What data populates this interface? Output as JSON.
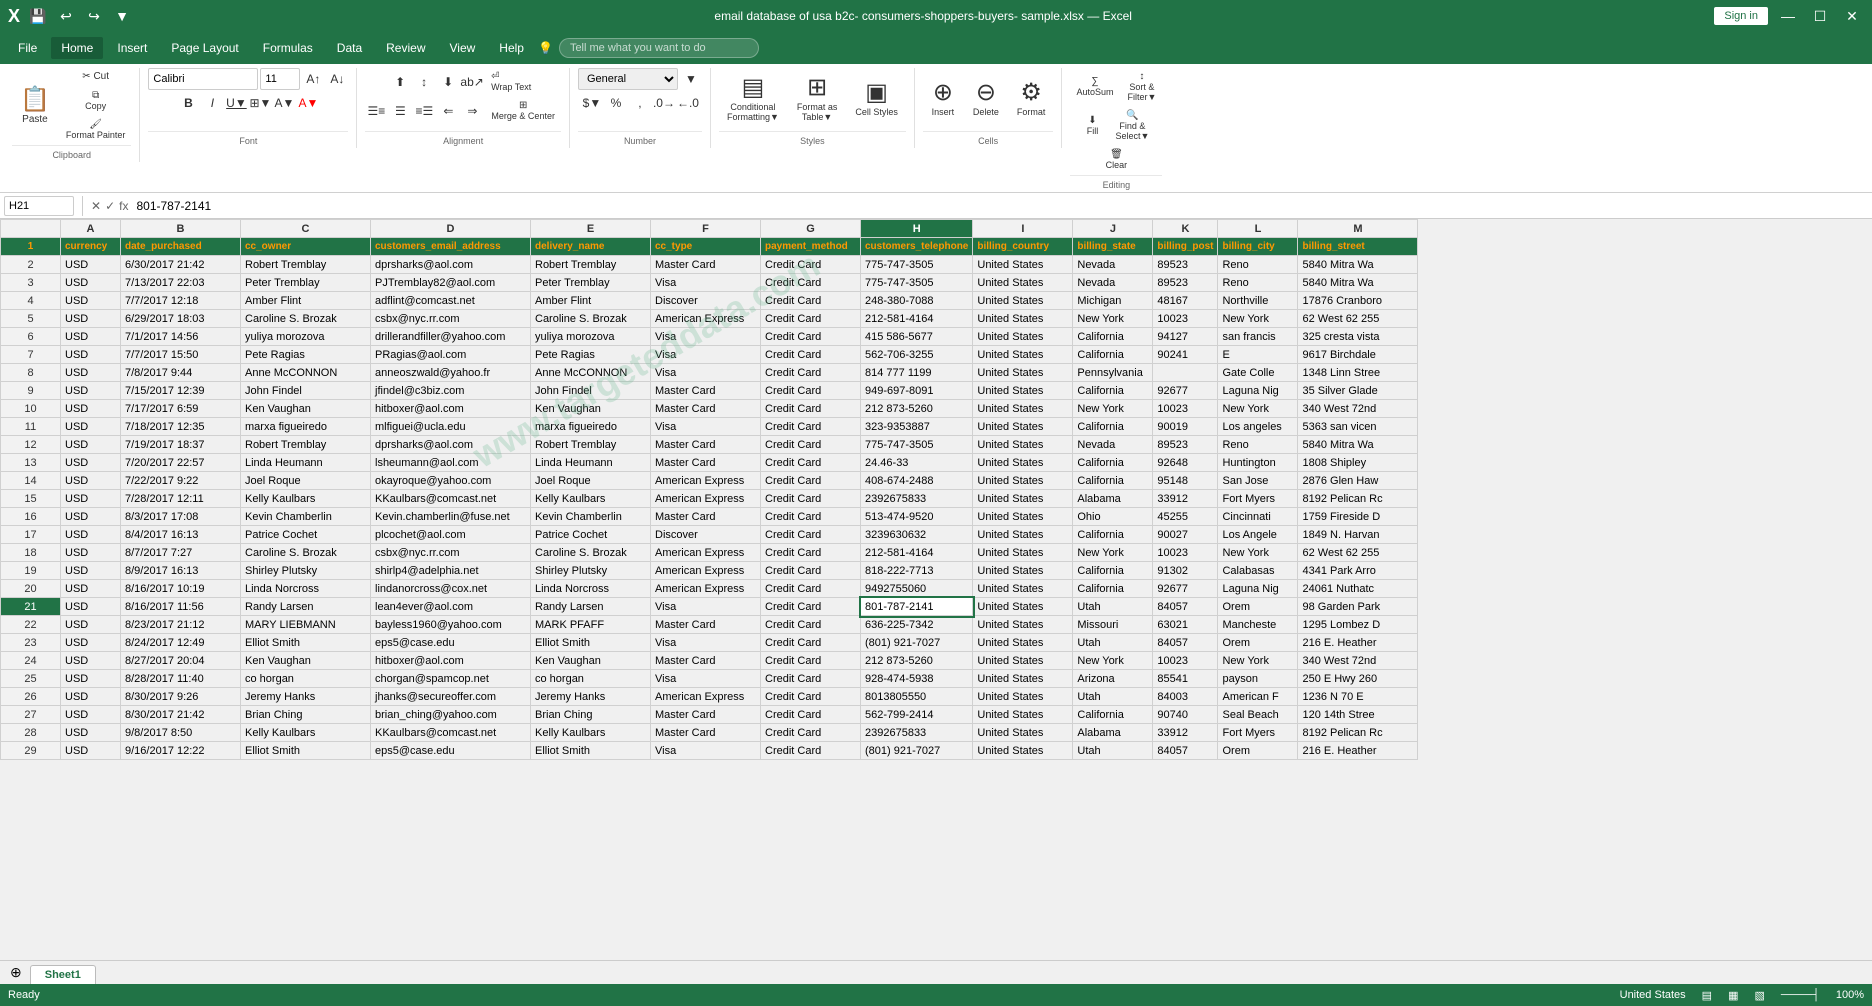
{
  "titleBar": {
    "filename": "email database of usa b2c- consumers-shoppers-buyers- sample.xlsx — Excel",
    "signIn": "Sign in"
  },
  "quickAccess": [
    "💾",
    "↩",
    "↪",
    "▼"
  ],
  "menuItems": [
    "File",
    "Home",
    "Insert",
    "Page Layout",
    "Formulas",
    "Data",
    "Review",
    "View",
    "Help"
  ],
  "activeMenu": "Home",
  "tellMe": {
    "placeholder": "Tell me what you want to do"
  },
  "ribbon": {
    "clipboard": {
      "label": "Clipboard",
      "paste": "Paste",
      "cut": "Cut",
      "copy": "Copy",
      "formatPainter": "Format Painter"
    },
    "font": {
      "label": "Font",
      "fontName": "Calibri",
      "fontSize": "11",
      "bold": "B",
      "italic": "I",
      "underline": "U"
    },
    "alignment": {
      "label": "Alignment",
      "wrapText": "Wrap Text",
      "mergeCenter": "Merge & Center"
    },
    "number": {
      "label": "Number",
      "format": "General"
    },
    "styles": {
      "label": "Styles",
      "conditional": "Conditional Formatting",
      "formatAsTable": "Format as Table",
      "cellStyles": "Cell Styles"
    },
    "cells": {
      "label": "Cells",
      "insert": "Insert",
      "delete": "Delete",
      "format": "Format"
    },
    "editing": {
      "label": "Editing",
      "autoSum": "AutoSum",
      "fill": "Fill",
      "clear": "Clear",
      "sortFilter": "Sort & Filter",
      "findSelect": "Find & Select"
    }
  },
  "formulaBar": {
    "nameBox": "H21",
    "formula": "801-787-2141"
  },
  "headers": [
    "currency",
    "date_purchased",
    "cc_owner",
    "customers_email_address",
    "delivery_name",
    "cc_type",
    "payment_method",
    "customers_telephone",
    "billing_country",
    "billing_state",
    "billing_post",
    "billing_city",
    "billing_street"
  ],
  "rows": [
    [
      "USD",
      "6/30/2017 21:42",
      "Robert Tremblay",
      "dprsharks@aol.com",
      "Robert Tremblay",
      "Master Card",
      "Credit Card",
      "775-747-3505",
      "United States",
      "Nevada",
      "89523",
      "Reno",
      "5840 Mitra Wa"
    ],
    [
      "USD",
      "7/13/2017 22:03",
      "Peter Tremblay",
      "PJTremblay82@aol.com",
      "Peter Tremblay",
      "Visa",
      "Credit Card",
      "775-747-3505",
      "United States",
      "Nevada",
      "89523",
      "Reno",
      "5840 Mitra Wa"
    ],
    [
      "USD",
      "7/7/2017 12:18",
      "Amber Flint",
      "adflint@comcast.net",
      "Amber Flint",
      "Discover",
      "Credit Card",
      "248-380-7088",
      "United States",
      "Michigan",
      "48167",
      "Northville",
      "17876 Cranboro"
    ],
    [
      "USD",
      "6/29/2017 18:03",
      "Caroline S. Brozak",
      "csbx@nyc.rr.com",
      "Caroline S. Brozak",
      "American Express",
      "Credit Card",
      "212-581-4164",
      "United States",
      "New York",
      "10023",
      "New York",
      "62 West 62 255"
    ],
    [
      "USD",
      "7/1/2017 14:56",
      "yuliya morozova",
      "drillerandfiller@yahoo.com",
      "yuliya morozova",
      "Visa",
      "Credit Card",
      "415 586-5677",
      "United States",
      "California",
      "94127",
      "san francis",
      "325 cresta vista"
    ],
    [
      "USD",
      "7/7/2017 15:50",
      "Pete Ragias",
      "PRagias@aol.com",
      "Pete Ragias",
      "Visa",
      "Credit Card",
      "562-706-3255",
      "United States",
      "California",
      "90241",
      "E",
      "9617 Birchdale"
    ],
    [
      "USD",
      "7/8/2017 9:44",
      "Anne McCONNON",
      "anneoszwald@yahoo.fr",
      "Anne McCONNON",
      "Visa",
      "Credit Card",
      "814 777 1199",
      "United States",
      "Pennsylvania",
      "",
      "Gate Colle",
      "1348 Linn Stree"
    ],
    [
      "USD",
      "7/15/2017 12:39",
      "John Findel",
      "jfindel@c3biz.com",
      "John Findel",
      "Master Card",
      "Credit Card",
      "949-697-8091",
      "United States",
      "California",
      "92677",
      "Laguna Nig",
      "35 Silver Glade"
    ],
    [
      "USD",
      "7/17/2017 6:59",
      "Ken Vaughan",
      "hitboxer@aol.com",
      "Ken Vaughan",
      "Master Card",
      "Credit Card",
      "212 873-5260",
      "United States",
      "New York",
      "10023",
      "New York",
      "340 West 72nd"
    ],
    [
      "USD",
      "7/18/2017 12:35",
      "marxa figueiredo",
      "mlfiguei@ucla.edu",
      "marxa figueiredo",
      "Visa",
      "Credit Card",
      "323-9353887",
      "United States",
      "California",
      "90019",
      "Los angeles",
      "5363 san vicen"
    ],
    [
      "USD",
      "7/19/2017 18:37",
      "Robert Tremblay",
      "dprsharks@aol.com",
      "Robert Tremblay",
      "Master Card",
      "Credit Card",
      "775-747-3505",
      "United States",
      "Nevada",
      "89523",
      "Reno",
      "5840 Mitra Wa"
    ],
    [
      "USD",
      "7/20/2017 22:57",
      "Linda Heumann",
      "lsheumann@aol.com",
      "Linda Heumann",
      "Master Card",
      "Credit Card",
      "24.46-33",
      "United States",
      "California",
      "92648",
      "Huntington",
      "1808 Shipley"
    ],
    [
      "USD",
      "7/22/2017 9:22",
      "Joel Roque",
      "okayroque@yahoo.com",
      "Joel Roque",
      "American Express",
      "Credit Card",
      "408-674-2488",
      "United States",
      "California",
      "95148",
      "San Jose",
      "2876 Glen Haw"
    ],
    [
      "USD",
      "7/28/2017 12:11",
      "Kelly Kaulbars",
      "KKaulbars@comcast.net",
      "Kelly Kaulbars",
      "American Express",
      "Credit Card",
      "2392675833",
      "United States",
      "Alabama",
      "33912",
      "Fort Myers",
      "8192 Pelican Rc"
    ],
    [
      "USD",
      "8/3/2017 17:08",
      "Kevin Chamberlin",
      "Kevin.chamberlin@fuse.net",
      "Kevin Chamberlin",
      "Master Card",
      "Credit Card",
      "513-474-9520",
      "United States",
      "Ohio",
      "45255",
      "Cincinnati",
      "1759 Fireside D"
    ],
    [
      "USD",
      "8/4/2017 16:13",
      "Patrice Cochet",
      "plcochet@aol.com",
      "Patrice Cochet",
      "Discover",
      "Credit Card",
      "3239630632",
      "United States",
      "California",
      "90027",
      "Los Angele",
      "1849 N. Harvan"
    ],
    [
      "USD",
      "8/7/2017 7:27",
      "Caroline S. Brozak",
      "csbx@nyc.rr.com",
      "Caroline S. Brozak",
      "American Express",
      "Credit Card",
      "212-581-4164",
      "United States",
      "New York",
      "10023",
      "New York",
      "62 West 62 255"
    ],
    [
      "USD",
      "8/9/2017 16:13",
      "Shirley Plutsky",
      "shirlp4@adelphia.net",
      "Shirley Plutsky",
      "American Express",
      "Credit Card",
      "818-222-7713",
      "United States",
      "California",
      "91302",
      "Calabasas",
      "4341 Park Arro"
    ],
    [
      "USD",
      "8/16/2017 10:19",
      "Linda Norcross",
      "lindanorcross@cox.net",
      "Linda Norcross",
      "American Express",
      "Credit Card",
      "9492755060",
      "United States",
      "California",
      "92677",
      "Laguna Nig",
      "24061 Nuthatc"
    ],
    [
      "USD",
      "8/16/2017 11:56",
      "Randy Larsen",
      "lean4ever@aol.com",
      "Randy Larsen",
      "Visa",
      "Credit Card",
      "801-787-2141",
      "United States",
      "Utah",
      "84057",
      "Orem",
      "98 Garden Park"
    ],
    [
      "USD",
      "8/23/2017 21:12",
      "MARY LIEBMANN",
      "bayless1960@yahoo.com",
      "MARK PFAFF",
      "Master Card",
      "Credit Card",
      "636-225-7342",
      "United States",
      "Missouri",
      "63021",
      "Mancheste",
      "1295 Lombez D"
    ],
    [
      "USD",
      "8/24/2017 12:49",
      "Elliot Smith",
      "eps5@case.edu",
      "Elliot Smith",
      "Visa",
      "Credit Card",
      "(801) 921-7027",
      "United States",
      "Utah",
      "84057",
      "Orem",
      "216 E. Heather"
    ],
    [
      "USD",
      "8/27/2017 20:04",
      "Ken Vaughan",
      "hitboxer@aol.com",
      "Ken Vaughan",
      "Master Card",
      "Credit Card",
      "212 873-5260",
      "United States",
      "New York",
      "10023",
      "New York",
      "340 West 72nd"
    ],
    [
      "USD",
      "8/28/2017 11:40",
      "co horgan",
      "chorgan@spamcop.net",
      "co horgan",
      "Visa",
      "Credit Card",
      "928-474-5938",
      "United States",
      "Arizona",
      "85541",
      "payson",
      "250 E Hwy 260"
    ],
    [
      "USD",
      "8/30/2017 9:26",
      "Jeremy Hanks",
      "jhanks@secureoffer.com",
      "Jeremy Hanks",
      "American Express",
      "Credit Card",
      "8013805550",
      "United States",
      "Utah",
      "84003",
      "American F",
      "1236 N 70 E"
    ],
    [
      "USD",
      "8/30/2017 21:42",
      "Brian Ching",
      "brian_ching@yahoo.com",
      "Brian Ching",
      "Master Card",
      "Credit Card",
      "562-799-2414",
      "United States",
      "California",
      "90740",
      "Seal Beach",
      "120 14th Stree"
    ],
    [
      "USD",
      "9/8/2017 8:50",
      "Kelly Kaulbars",
      "KKaulbars@comcast.net",
      "Kelly Kaulbars",
      "Master Card",
      "Credit Card",
      "2392675833",
      "United States",
      "Alabama",
      "33912",
      "Fort Myers",
      "8192 Pelican Rc"
    ],
    [
      "USD",
      "9/16/2017 12:22",
      "Elliot Smith",
      "eps5@case.edu",
      "Elliot Smith",
      "Visa",
      "Credit Card",
      "(801) 921-7027",
      "United States",
      "Utah",
      "84057",
      "Orem",
      "216 E. Heather"
    ]
  ],
  "statusBar": {
    "left": "Ready",
    "country": "United States",
    "zoom": "100%",
    "zoomLabel": "🔍"
  },
  "sheetTab": "Sheet1",
  "activeCell": "H21",
  "activeCol": "H"
}
